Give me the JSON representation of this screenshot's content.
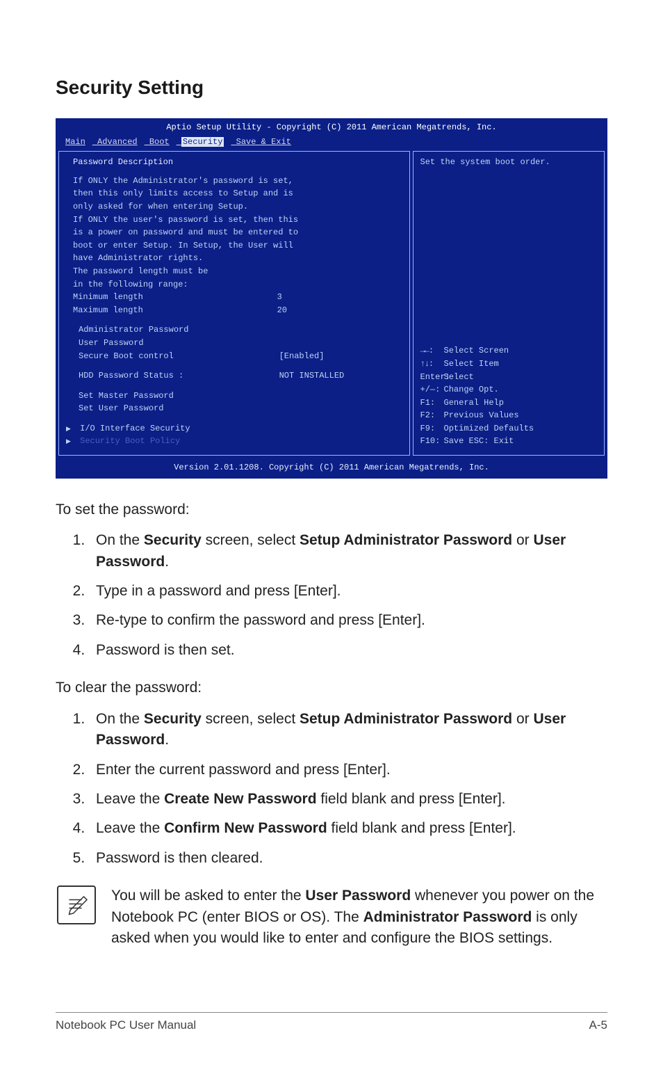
{
  "heading": "Security Setting",
  "bios": {
    "banner": "Aptio Setup Utility - Copyright (C) 2011 American Megatrends, Inc.",
    "tabs": [
      "Main",
      "Advanced",
      "Boot",
      "Security",
      "Save & Exit"
    ],
    "active_tab": "Security",
    "left": {
      "title": "Password Description",
      "desc_lines": [
        "If ONLY the Administrator's password is set,",
        "then this only limits access to Setup and is",
        "only asked for when entering Setup.",
        "If ONLY the user's password is set, then this",
        "is a power on password and must be entered to",
        "boot or enter Setup. In Setup, the User will",
        "have Administrator rights.",
        "The password length must be",
        "in the following range:"
      ],
      "min_label": "Minimum length",
      "min_value": "3",
      "max_label": "Maximum length",
      "max_value": "20",
      "admin_pw": "Administrator Password",
      "user_pw": "User Password",
      "secure_label": "Secure Boot control",
      "secure_value": "[Enabled]",
      "hdd_label": "HDD Password Status :",
      "hdd_value": "NOT INSTALLED",
      "set_master": "Set Master Password",
      "set_user": "Set User Password",
      "io_sec": "I/O Interface Security",
      "boot_policy": "Security Boot Policy"
    },
    "right": {
      "help_top": "Set the system boot order.",
      "help_lines": [
        {
          "k": "→←:",
          "v": "Select Screen"
        },
        {
          "k": "↑↓:",
          "v": "Select Item"
        },
        {
          "k": "Enter:",
          "v": "Select"
        },
        {
          "k": "+/—:",
          "v": "Change Opt."
        },
        {
          "k": "F1:",
          "v": "General Help"
        },
        {
          "k": "F2:",
          "v": "Previous Values"
        },
        {
          "k": "F9:",
          "v": "Optimized Defaults"
        },
        {
          "k": "F10:",
          "v": "Save   ESC: Exit"
        }
      ]
    },
    "footer": "Version 2.01.1208. Copyright (C) 2011 American Megatrends, Inc."
  },
  "instr": {
    "set_intro": "To set the password:",
    "set_steps": [
      "On the <b>Security</b> screen, select <b>Setup Administrator Password</b> or <b>User Password</b>.",
      "Type in a password and press [Enter].",
      "Re-type to confirm the password and press [Enter].",
      "Password is then set."
    ],
    "clear_intro": "To clear the password:",
    "clear_steps": [
      "On the <b>Security</b> screen, select <b>Setup Administrator Password</b> or <b>User Password</b>.",
      "Enter the current password and press [Enter].",
      "Leave the <b>Create New Password</b> field blank and press [Enter].",
      "Leave the <b>Confirm New Password</b> field blank and press [Enter].",
      "Password is then cleared."
    ],
    "note": "You will be asked to enter the <b>User Password</b> whenever you power on the Notebook PC (enter BIOS or OS). The <b>Administrator Password</b> is only asked when you would like to enter and configure the BIOS settings."
  },
  "footer": {
    "left": "Notebook PC User Manual",
    "right": "A-5"
  }
}
